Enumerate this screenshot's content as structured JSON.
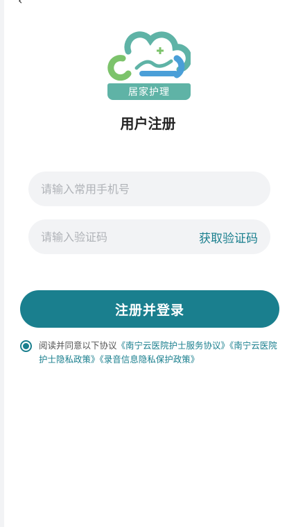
{
  "header": {
    "back_icon": "chevron-left-icon"
  },
  "logo": {
    "banner_text": "居家护理",
    "icon": "cloud-logo-icon",
    "colors": {
      "teal": "#5fb3a6",
      "blue": "#4a9fd8",
      "green": "#7cc36b"
    }
  },
  "page_title": "用户注册",
  "form": {
    "phone_placeholder": "请输入常用手机号",
    "phone_value": "",
    "code_placeholder": "请输入验证码",
    "code_value": "",
    "get_code_label": "获取验证码"
  },
  "submit_label": "注册并登录",
  "agreement": {
    "checked": true,
    "prefix": "阅读并同意以下协议",
    "link1": "《南宁云医院护士服务协议》",
    "link2": "《南宁云医院护士隐私政策》",
    "link3": "《录音信息隐私保护政策》"
  },
  "colors": {
    "accent": "#1a7f8e",
    "input_bg": "#f2f3f5"
  }
}
